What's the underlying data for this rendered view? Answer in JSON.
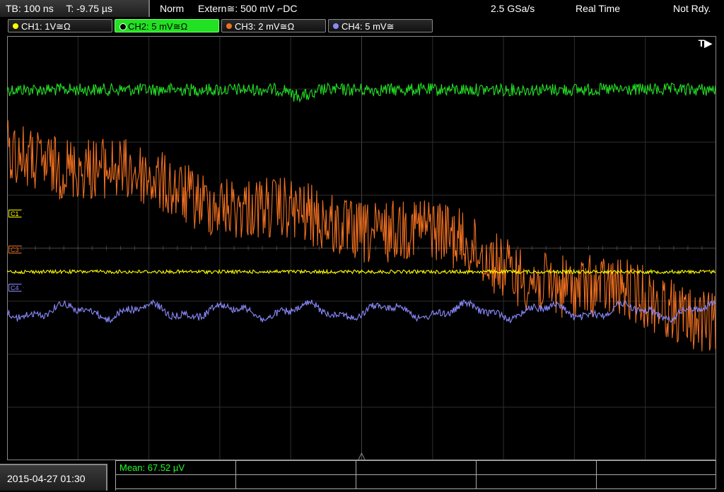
{
  "topbar": {
    "timebase": "TB: 100 ns",
    "trigger_time": "T: -9.75 µs",
    "trigger_mode": "Norm",
    "trigger_source": "Extern≅: 500 mV ⌐DC",
    "sample_rate": "2.5 GSa/s",
    "acquisition_mode": "Real Time",
    "status": "Not Rdy."
  },
  "channels": [
    {
      "label": "CH1: 1V≅Ω",
      "color": "#ffff00",
      "active": false
    },
    {
      "label": "CH2: 5 mV≅Ω",
      "color": "#22e022",
      "active": true
    },
    {
      "label": "CH3: 2 mV≅Ω",
      "color": "#f07020",
      "active": false
    },
    {
      "label": "CH4: 5 mV≅",
      "color": "#8a8aff",
      "active": false
    }
  ],
  "markers": {
    "c1": "C1",
    "c3": "C3",
    "c4": "C4"
  },
  "trigger_flag": "T▶",
  "measurement": {
    "label": "Mean: 67.52 µV"
  },
  "datetime": "2015-04-27 01:30",
  "colors": {
    "ch1": "#ffff00",
    "ch2": "#22e022",
    "ch3": "#f07020",
    "ch4": "#8a8aff",
    "grid": "#2e2e2e",
    "border": "#888888"
  }
}
